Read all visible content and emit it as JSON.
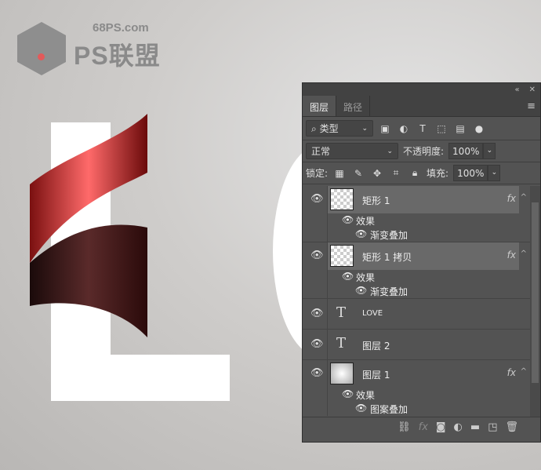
{
  "logo": {
    "url": "68PS.com",
    "name": "PS联盟"
  },
  "panel": {
    "tabs": [
      {
        "label": "图层"
      },
      {
        "label": "路径"
      }
    ],
    "filter": {
      "kind": "类型"
    },
    "blend_mode": "正常",
    "opacity": {
      "label": "不透明度:",
      "value": "100%"
    },
    "lock_label": "锁定:",
    "fill": {
      "label": "填充:",
      "value": "100%"
    },
    "layers": [
      {
        "name": "矩形 1",
        "fx": "fx",
        "effects_label": "效果",
        "effects": [
          "渐变叠加"
        ]
      },
      {
        "name": "矩形 1 拷贝",
        "fx": "fx",
        "effects_label": "效果",
        "effects": [
          "渐变叠加"
        ]
      },
      {
        "name": "LOVE"
      },
      {
        "name": "图层 2"
      },
      {
        "name": "图层 1",
        "fx": "fx",
        "effects_label": "效果",
        "effects": [
          "图案叠加"
        ]
      }
    ]
  }
}
